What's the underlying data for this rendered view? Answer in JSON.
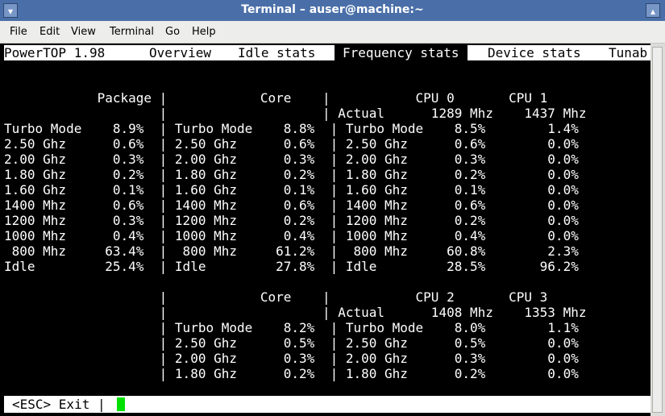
{
  "window": {
    "title": "Terminal – auser@machine:~"
  },
  "menubar": [
    "File",
    "Edit",
    "View",
    "Terminal",
    "Go",
    "Help"
  ],
  "powertop": {
    "app": "PowerTOP 1.98",
    "tabs": [
      "Overview",
      "Idle stats",
      "Frequency stats",
      "Device stats",
      "Tunab"
    ],
    "active_tab": "Frequency stats"
  },
  "freq_lines": [
    "",
    "            Package |            Core    |           CPU 0       CPU 1",
    "                    |                    | Actual      1289 Mhz    1437 Mhz",
    "Turbo Mode    8.9%  | Turbo Mode    8.8%  | Turbo Mode    8.5%        1.4%",
    "2.50 Ghz      0.6%  | 2.50 Ghz      0.6%  | 2.50 Ghz      0.6%        0.0%",
    "2.00 Ghz      0.3%  | 2.00 Ghz      0.3%  | 2.00 Ghz      0.3%        0.0%",
    "1.80 Ghz      0.2%  | 1.80 Ghz      0.2%  | 1.80 Ghz      0.2%        0.0%",
    "1.60 Ghz      0.1%  | 1.60 Ghz      0.1%  | 1.60 Ghz      0.1%        0.0%",
    "1400 Mhz      0.6%  | 1400 Mhz      0.6%  | 1400 Mhz      0.6%        0.0%",
    "1200 Mhz      0.3%  | 1200 Mhz      0.2%  | 1200 Mhz      0.2%        0.0%",
    "1000 Mhz      0.4%  | 1000 Mhz      0.4%  | 1000 Mhz      0.4%        0.0%",
    " 800 Mhz     63.4%  |  800 Mhz     61.2%  |  800 Mhz     60.8%        2.3%",
    "Idle         25.4%  | Idle         27.8%  | Idle         28.5%       96.2%",
    "",
    "                    |            Core    |           CPU 2       CPU 3",
    "                    |                    | Actual      1408 Mhz    1353 Mhz",
    "                    | Turbo Mode    8.2%  | Turbo Mode    8.0%        1.1%",
    "                    | 2.50 Ghz      0.5%  | 2.50 Ghz      0.5%        0.0%",
    "                    | 2.00 Ghz      0.3%  | 2.00 Ghz      0.3%        0.0%",
    "                    | 1.80 Ghz      0.2%  | 1.80 Ghz      0.2%        0.0%"
  ],
  "bottom": {
    "text": "<ESC> Exit |"
  },
  "colors": {
    "titlebar": "#4a6fa8",
    "terminal_bg": "#000000",
    "terminal_fg": "#ffffff",
    "cursor": "#00e000"
  }
}
